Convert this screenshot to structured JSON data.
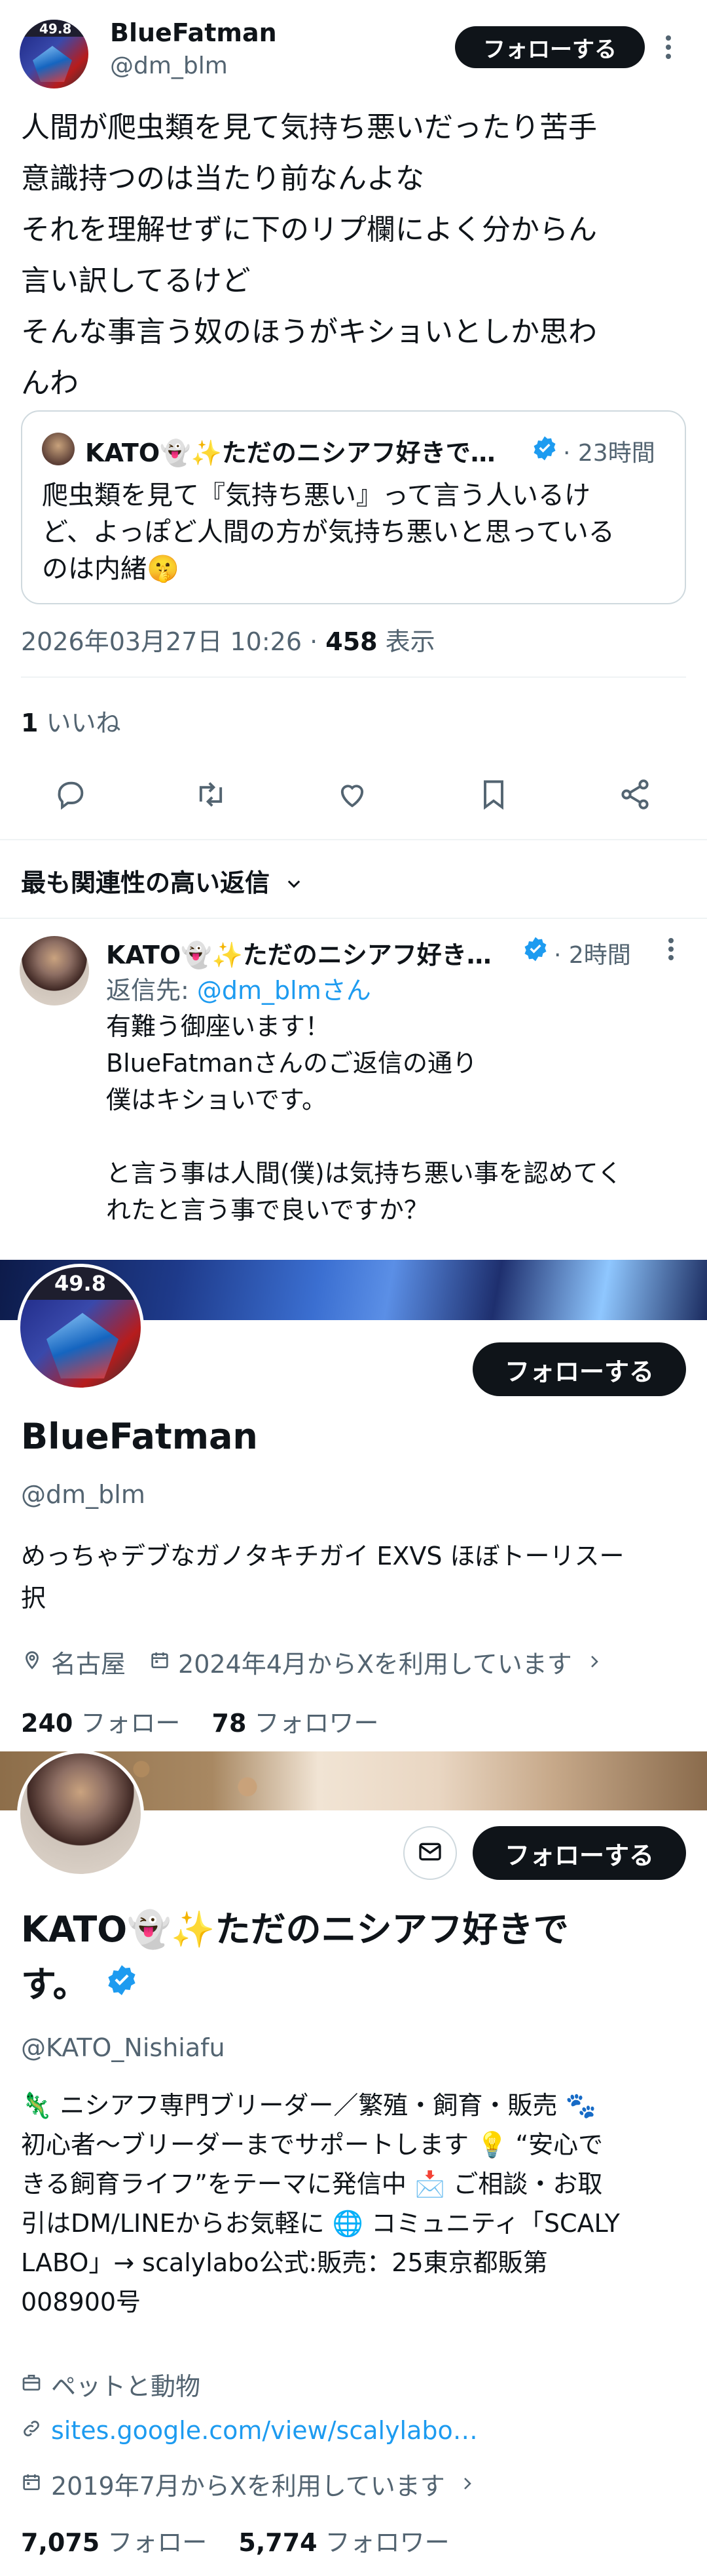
{
  "tweet": {
    "author_name": "BlueFatman",
    "author_handle": "@dm_blm",
    "avatar_badge": "49.8",
    "follow_label": "フォローする",
    "text_lines": [
      "人間が爬虫類を見て気持ち悪いだったり苦手",
      "意識持つのは当たり前なんよな",
      "それを理解せずに下のリプ欄によく分からん",
      "言い訳してるけど",
      "そんな事言う奴のほうがキショいとしか思わ",
      "んわ"
    ],
    "quote": {
      "author": "KATO👻✨ただのニシアフ好きで…",
      "time": "· 23時間",
      "text_lines": [
        "爬虫類を見て『気持ち悪い』って言う人いるけ",
        "ど、よっぽど人間の方が気持ち悪いと思っている",
        "のは内緒🤫"
      ]
    },
    "timestamp": "2026年03月27日 10:26 · ",
    "views_count": "458",
    "views_label": " 表示",
    "likes_count": "1",
    "likes_label": " いいね",
    "sort_label": "最も関連性の高い返信"
  },
  "reply": {
    "author": "KATO👻✨ただのニシアフ好き…",
    "time": "· 2時間",
    "reply_to_prefix": "返信先: ",
    "reply_to_handle": "@dm_blmさん",
    "text_lines": [
      "有難う御座います！",
      "BlueFatmanさんのご返信の通り",
      "僕はキショいです。",
      "",
      "と言う事は人間(僕)は気持ち悪い事を認めてく",
      "れたと言う事で良いですか？"
    ]
  },
  "profile1": {
    "name": "BlueFatman",
    "handle": "@dm_blm",
    "avatar_badge": "49.8",
    "follow_label": "フォローする",
    "bio_lines": [
      "めっちゃデブなガノタキチガイ EXVS ほぼトーリスー",
      "択"
    ],
    "location": "名古屋",
    "joined": "2024年4月からXを利用しています",
    "following_count": "240",
    "following_label": " フォロー",
    "followers_count": "78",
    "followers_label": " フォロワー"
  },
  "profile2": {
    "name_line1": "KATO👻✨ただのニシアフ好きで",
    "name_line2": "す。",
    "handle": "@KATO_Nishiafu",
    "follow_label": "フォローする",
    "bio_lines": [
      "🦎 ニシアフ専門ブリーダー／繁殖・飼育・販売 🐾",
      "初心者〜ブリーダーまでサポートします 💡 “安心で",
      "きる飼育ライフ”をテーマに発信中 📩 ご相談・お取",
      "引はDM/LINEからお気軽に 🌐 コミュニティ「SCALY",
      "LABO」→ scalylabo公式:販売：25東京都販第",
      "008900号"
    ],
    "category": "ペットと動物",
    "website": "sites.google.com/view/scalylabo…",
    "joined": "2019年7月からXを利用しています",
    "following_count": "7,075",
    "following_label": " フォロー",
    "followers_count": "5,774",
    "followers_label": " フォロワー"
  },
  "colors": {
    "accent": "#1d9bf0",
    "text": "#0f1419",
    "muted": "#536471",
    "divider": "#eff3f4"
  }
}
